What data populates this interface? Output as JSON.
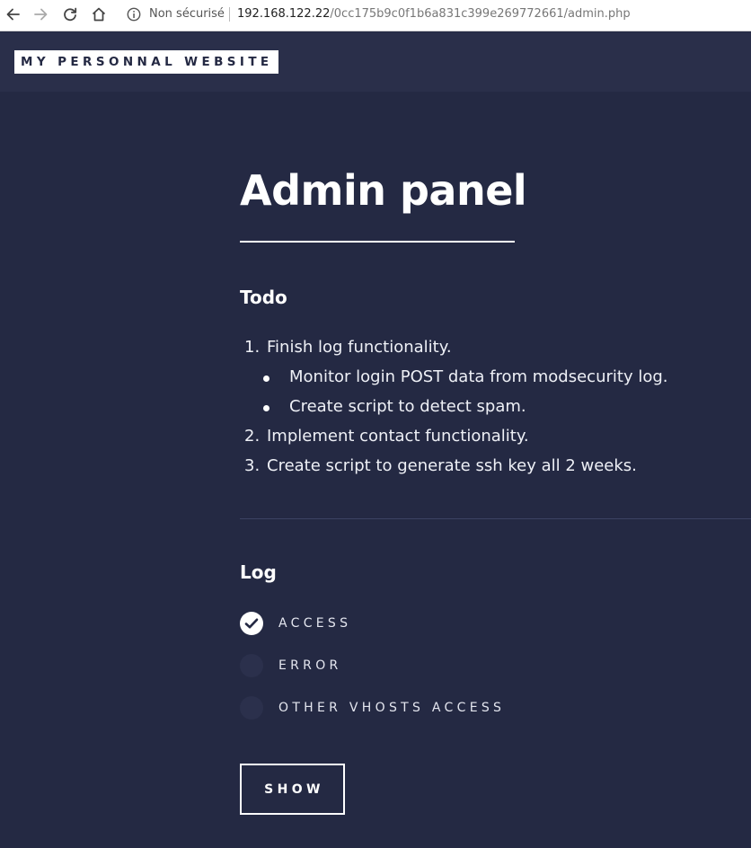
{
  "browser": {
    "security_label": "Non sécurisé",
    "url_host": "192.168.122.22",
    "url_path": "/0cc175b9c0f1b6a831c399e269772661/admin.php",
    "icons": [
      "back-icon",
      "forward-icon",
      "reload-icon",
      "home-icon",
      "info-icon"
    ]
  },
  "header": {
    "logo": "MY PERSONNAL WEBSITE"
  },
  "main": {
    "title": "Admin panel",
    "todo": {
      "heading": "Todo",
      "items": [
        {
          "number": "1.",
          "text": "Finish log functionality."
        },
        {
          "text": "Monitor login POST data from modsecurity log."
        },
        {
          "text": "Create script to detect spam."
        },
        {
          "number": "2.",
          "text": "Implement contact functionality."
        },
        {
          "number": "3.",
          "text": "Create script to generate ssh key all 2 weeks."
        }
      ]
    },
    "log": {
      "heading": "Log",
      "options": [
        {
          "label": "ACCESS",
          "checked": true
        },
        {
          "label": "ERROR",
          "checked": false
        },
        {
          "label": "OTHER VHOSTS ACCESS",
          "checked": false
        }
      ],
      "show_button": "SHOW"
    }
  },
  "colors": {
    "background": "#242943",
    "header": "#2a2f4a",
    "text": "#ffffff"
  }
}
